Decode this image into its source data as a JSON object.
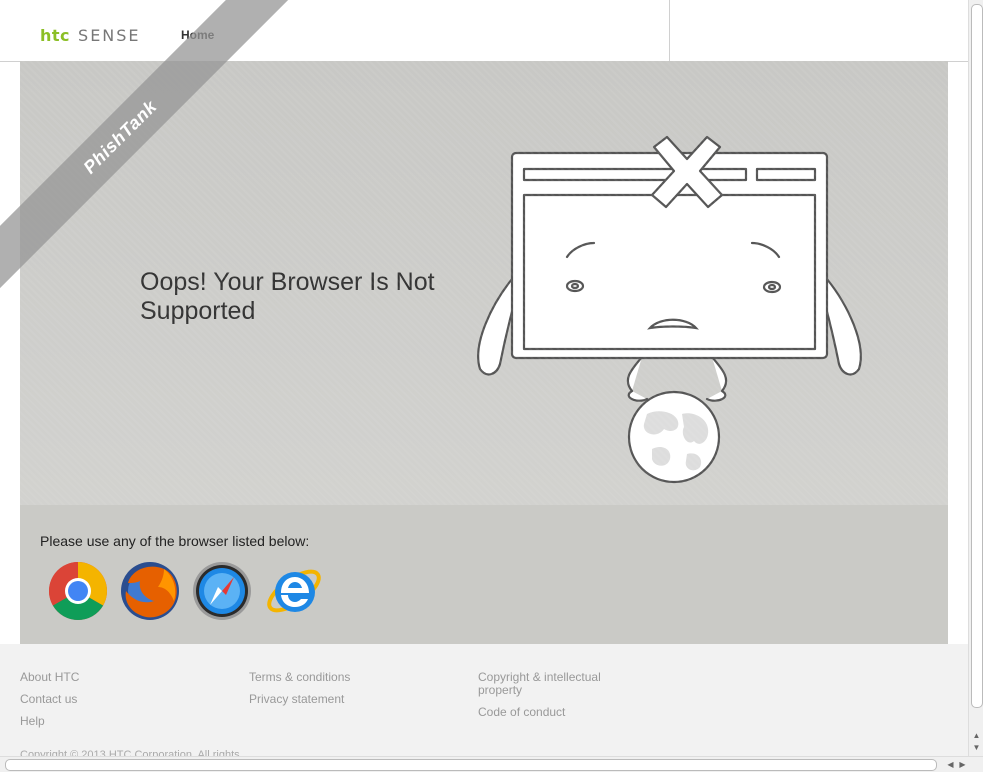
{
  "header": {
    "logo_brand": "htc",
    "logo_product": "SENSE",
    "nav_home": "Home"
  },
  "main": {
    "headline": "Oops! Your Browser Is Not Supported"
  },
  "browsers": {
    "label": "Please use any of the browser listed below:",
    "items": [
      {
        "name": "chrome-icon"
      },
      {
        "name": "firefox-icon"
      },
      {
        "name": "safari-icon"
      },
      {
        "name": "ie-icon"
      }
    ]
  },
  "footer": {
    "col1": [
      "About HTC",
      "Contact us",
      "Help"
    ],
    "col2": [
      "Terms & conditions",
      "Privacy statement"
    ],
    "col3": [
      "Copyright & intellectual property",
      "Code of conduct"
    ],
    "copyright": "Copyright © 2013 HTC Corporation. All rights"
  },
  "watermark": "PhishTank",
  "colors": {
    "brand_green": "#8cbf26",
    "main_bg": "#c8c8c5",
    "band_bg": "#cacac6",
    "footer_bg": "#f2f2f2"
  }
}
